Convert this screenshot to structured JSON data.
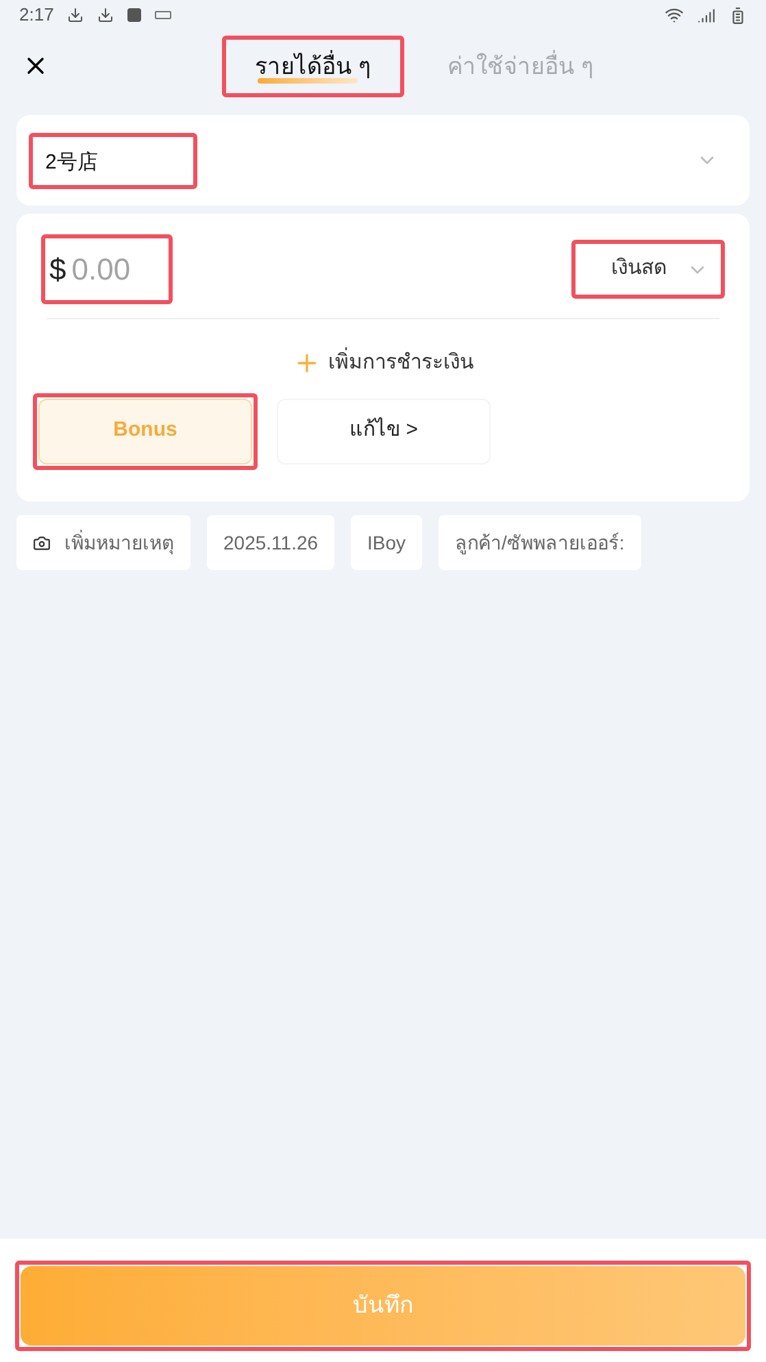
{
  "status_bar": {
    "time": "2:17"
  },
  "tabs": [
    {
      "label": "รายได้อื่น ๆ",
      "selected": true,
      "highlighted": true
    },
    {
      "label": "ค่าใช้จ่ายอื่น ๆ",
      "selected": false,
      "highlighted": false
    }
  ],
  "store": {
    "value": "2号店",
    "highlighted": true
  },
  "amount": {
    "currency": "$",
    "placeholder": "0.00",
    "highlighted": true
  },
  "payment_method": {
    "value": "เงินสด",
    "highlighted": true
  },
  "add_payment": "เพิ่มการชำระเงิน",
  "options": [
    {
      "label": "Bonus",
      "selected": true,
      "highlighted": true
    },
    {
      "label": "แก้ไข >",
      "selected": false,
      "highlighted": false
    }
  ],
  "chips": [
    {
      "kind": "note",
      "label": "เพิ่มหมายเหตุ"
    },
    {
      "kind": "text",
      "label": "2025.11.26"
    },
    {
      "kind": "text",
      "label": "IBoy"
    },
    {
      "kind": "text",
      "label": "ลูกค้า/ซัพพลายเออร์:"
    }
  ],
  "save": {
    "label": "บันทึก",
    "highlighted": true
  }
}
